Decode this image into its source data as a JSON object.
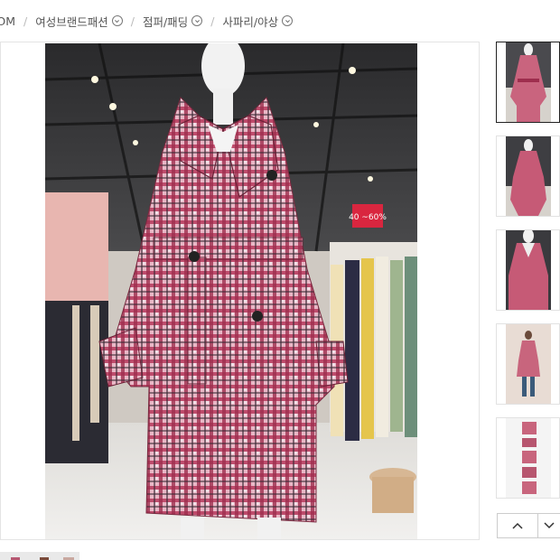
{
  "breadcrumb": {
    "items": [
      {
        "label": "G.COM",
        "has_dropdown": false
      },
      {
        "label": "여성브랜드패션",
        "has_dropdown": true
      },
      {
        "label": "점퍼/패딩",
        "has_dropdown": true
      },
      {
        "label": "사파리/야상",
        "has_dropdown": true
      }
    ],
    "separator": "/"
  },
  "main_image": {
    "sale_tag": "40 ~60%",
    "alt": "pink plaid trench coat on mannequin"
  },
  "thumbnails": {
    "active_index": 0,
    "count": 5
  },
  "nav": {
    "up_icon": "chevron-up-icon",
    "down_icon": "chevron-down-icon"
  },
  "colors": {
    "coat_pink": "#c24a6a",
    "coat_light": "#e9b7c6",
    "sale_tag": "#d9263f"
  }
}
